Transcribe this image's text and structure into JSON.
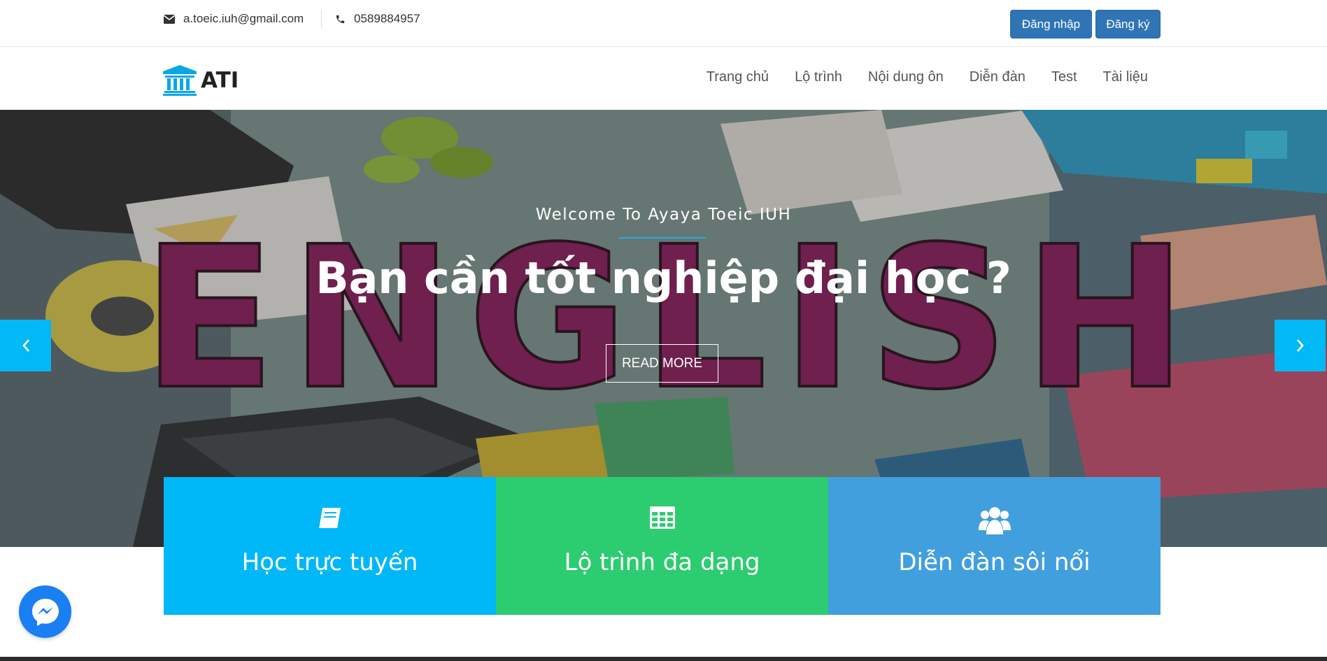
{
  "topbar": {
    "email": "a.toeic.iuh@gmail.com",
    "phone": "0589884957",
    "login_label": "Đăng nhập",
    "register_label": "Đăng ký"
  },
  "navbar": {
    "logo_text": "ATI",
    "items": [
      {
        "label": "Trang chủ"
      },
      {
        "label": "Lộ trình"
      },
      {
        "label": "Nội dung ôn"
      },
      {
        "label": "Diễn đàn"
      },
      {
        "label": "Test"
      },
      {
        "label": "Tài liệu"
      }
    ]
  },
  "hero": {
    "subtitle": "Welcome To Ayaya Toeic IUH",
    "title": "Bạn cần tốt nghiệp đại học ?",
    "button_label": "READ MORE",
    "background_word": "ENGLISH"
  },
  "features": [
    {
      "label": "Học trực tuyến",
      "icon": "book-icon",
      "color": "#00b7f7"
    },
    {
      "label": "Lộ trình đa dạng",
      "icon": "grid-icon",
      "color": "#2ccc70"
    },
    {
      "label": "Diễn đàn sôi nổi",
      "icon": "users-icon",
      "color": "#429fdd"
    }
  ],
  "colors": {
    "accent": "#02b8f5",
    "auth_button": "#2f74b5",
    "messenger": "#1a7ff2"
  }
}
